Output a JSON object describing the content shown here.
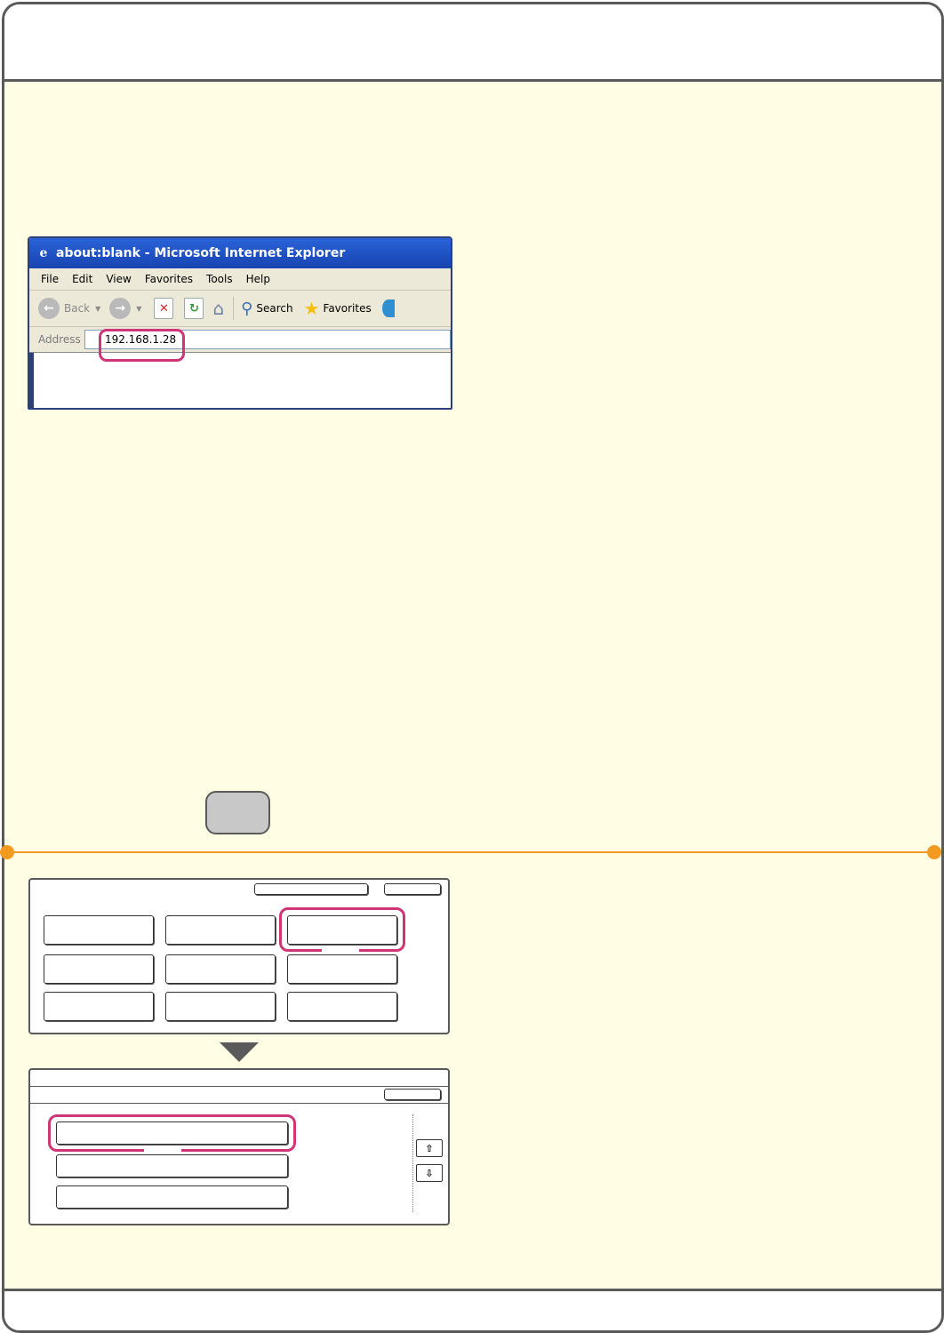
{
  "browser": {
    "title": "about:blank - Microsoft Internet Explorer",
    "menu": [
      "File",
      "Edit",
      "View",
      "Favorites",
      "Tools",
      "Help"
    ],
    "toolbar": {
      "back": "Back",
      "search": "Search",
      "favorites": "Favorites"
    },
    "address_label": "Address",
    "address_value": "192.168.1.28"
  },
  "colors": {
    "highlight": "#cf3577",
    "divider": "#f39a21",
    "body_background": "#fffde4",
    "frame": "#5a5a5a",
    "key_button": "#c8c8c8"
  }
}
